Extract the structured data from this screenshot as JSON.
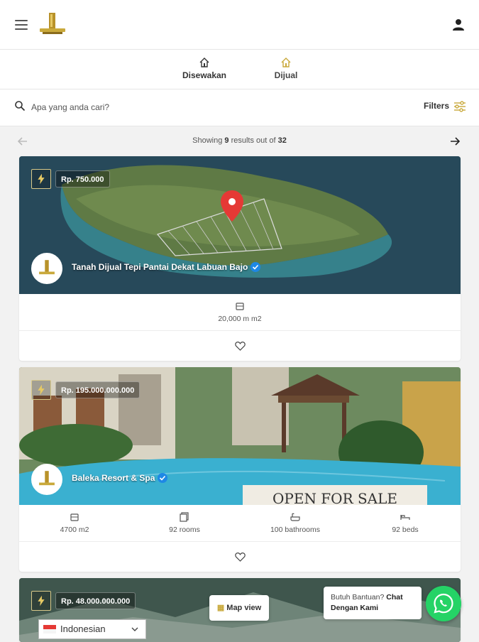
{
  "header": {
    "menu_icon": "hamburger-icon",
    "logo_icon": "gold-logo-icon",
    "user_icon": "user-icon"
  },
  "tabs": [
    {
      "label": "Disewakan",
      "icon": "house-icon",
      "active": false
    },
    {
      "label": "Dijual",
      "icon": "house-icon",
      "active": true
    }
  ],
  "search": {
    "placeholder": "Apa yang anda cari?",
    "filters_label": "Filters"
  },
  "pager": {
    "prefix": "Showing",
    "count": "9",
    "middle": "results out of",
    "total": "32"
  },
  "listings": [
    {
      "price": "Rp. 750.000",
      "title": "Tanah Dijual Tepi Pantai Dekat Labuan Bajo",
      "features": [
        {
          "icon": "area-icon",
          "label": "20,000 m m2"
        }
      ]
    },
    {
      "price": "Rp. 195.000.000.000",
      "title": "Baleka Resort & Spa",
      "features": [
        {
          "icon": "area-icon",
          "label": "4700 m2"
        },
        {
          "icon": "rooms-icon",
          "label": "92 rooms"
        },
        {
          "icon": "bathtub-icon",
          "label": "100 bathrooms"
        },
        {
          "icon": "bed-icon",
          "label": "92 beds"
        }
      ],
      "banner_text": "OPEN FOR SALE"
    },
    {
      "price": "Rp. 48.000.000.000"
    }
  ],
  "floating": {
    "map_view_label": "Map view",
    "help_prefix": "Butuh Bantuan?",
    "help_bold": "Chat Dengan Kami",
    "language": "Indonesian"
  },
  "colors": {
    "gold": "#c9a93b",
    "whatsapp": "#25d366"
  }
}
